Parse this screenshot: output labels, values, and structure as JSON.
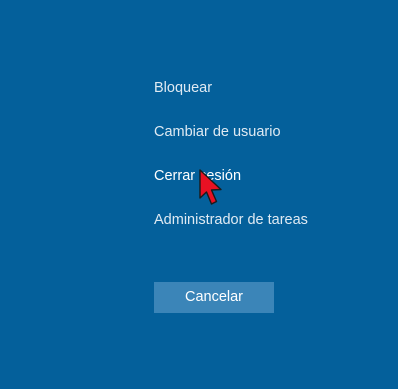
{
  "menu": {
    "items": [
      {
        "label": "Bloquear"
      },
      {
        "label": "Cambiar de usuario"
      },
      {
        "label": "Cerrar sesión"
      },
      {
        "label": "Administrador de tareas"
      }
    ]
  },
  "cancel_button": {
    "label": "Cancelar"
  },
  "colors": {
    "background": "#04609b",
    "button": "#3b85b8",
    "text": "#dfeaf3",
    "cursor": "#e81123"
  },
  "cursor": {
    "icon": "red-arrow-pointer-icon"
  }
}
